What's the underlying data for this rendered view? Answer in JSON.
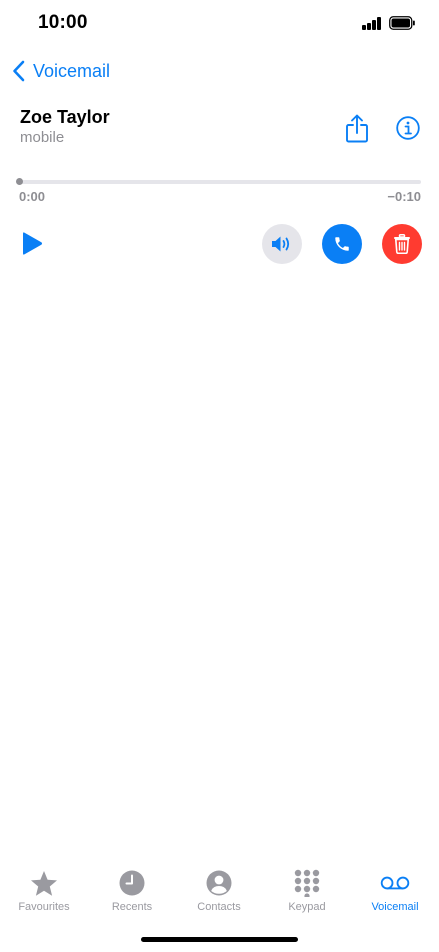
{
  "status_bar": {
    "time": "10:00"
  },
  "nav": {
    "back_label": "Voicemail"
  },
  "voicemail": {
    "contact_name": "Zoe Taylor",
    "number_type": "mobile",
    "elapsed": "0:00",
    "remaining": "−0:10",
    "progress": 0
  },
  "tabs": [
    {
      "label": "Favourites",
      "icon": "star-icon",
      "active": false
    },
    {
      "label": "Recents",
      "icon": "clock-icon",
      "active": false
    },
    {
      "label": "Contacts",
      "icon": "person-icon",
      "active": false
    },
    {
      "label": "Keypad",
      "icon": "keypad-icon",
      "active": false
    },
    {
      "label": "Voicemail",
      "icon": "voicemail-icon",
      "active": true
    }
  ],
  "colors": {
    "accent": "#0a7ff5",
    "delete": "#ff3b30",
    "speaker_bg": "#e5e5ea",
    "inactive_tab": "#9a9aa0"
  }
}
